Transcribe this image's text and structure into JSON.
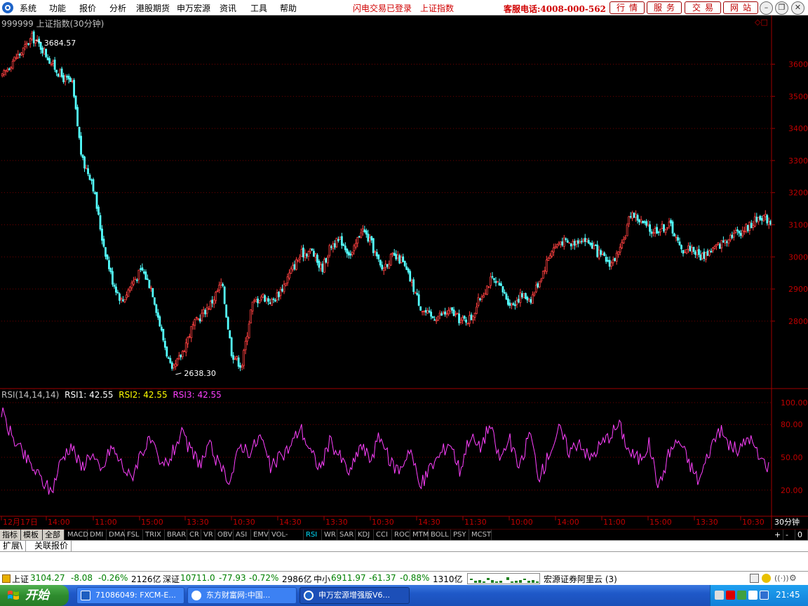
{
  "menu": {
    "items": [
      "系统",
      "功能",
      "报价",
      "分析",
      "港股期货",
      "申万宏源",
      "资讯",
      "工具",
      "帮助"
    ],
    "flash_status": "闪电交易已登录",
    "index_link": "上证指数",
    "hotline": "客服电话:4008-000-562",
    "buttons": [
      "行情",
      "服务",
      "交易",
      "网站"
    ],
    "window_controls": [
      "minimize-icon",
      "restore-icon",
      "close-icon"
    ]
  },
  "chart": {
    "title": "999999 上证指数(30分钟)",
    "controls": "◇□",
    "high_label": "3684.57",
    "low_label": "2638.30",
    "rsi_params": "RSI(14,14,14)",
    "rsi1": "RSI1: 42.55",
    "rsi2": "RSI2: 42.55",
    "rsi3": "RSI3: 42.55",
    "time_labels": [
      "12月17日",
      "14:00",
      "11:00",
      "15:00",
      "13:30",
      "10:30",
      "14:30",
      "13:30",
      "10:30",
      "14:30",
      "11:30",
      "10:00",
      "14:00",
      "11:00",
      "15:00",
      "13:30",
      "10:30"
    ],
    "period_label": "30分钟"
  },
  "chart_data": [
    {
      "type": "candlestick",
      "title": "999999 上证指数(30分钟)",
      "yticks": [
        3600,
        3500,
        3400,
        3300,
        3200,
        3100,
        3000,
        2900,
        2800
      ],
      "ylim": [
        2590,
        3730
      ],
      "annotations": [
        {
          "text": "3684.57",
          "value": 3684.57
        },
        {
          "text": "2638.30",
          "value": 2638.3
        }
      ],
      "close_path": [
        3560,
        3610,
        3640,
        3684.57,
        3650,
        3600,
        3560,
        3540,
        3300,
        3240,
        3060,
        2930,
        2860,
        2920,
        2960,
        2900,
        2760,
        2638.3,
        2700,
        2780,
        2820,
        2860,
        2920,
        2700,
        2660,
        2850,
        2880,
        2860,
        2900,
        2960,
        3010,
        3020,
        2960,
        3040,
        3050,
        3000,
        3090,
        3040,
        2960,
        3000,
        2990,
        2920,
        2840,
        2810,
        2820,
        2830,
        2800,
        2810,
        2880,
        2930,
        2900,
        2850,
        2880,
        2870,
        2940,
        3020,
        3050,
        3040,
        3060,
        3040,
        3000,
        2980,
        3020,
        3140,
        3110,
        3080,
        3090,
        3100,
        3020,
        3030,
        3000,
        3020,
        3040,
        3070,
        3080,
        3100,
        3130,
        3110
      ]
    },
    {
      "type": "line",
      "title": "RSI(14,14,14)",
      "yticks": [
        100.0,
        80.0,
        50.0,
        20.0
      ],
      "ylim": [
        0,
        100
      ],
      "series": [
        {
          "name": "RSI1",
          "last": 42.55
        },
        {
          "name": "RSI2",
          "last": 42.55
        },
        {
          "name": "RSI3",
          "last": 42.55
        }
      ],
      "rsi_path": [
        92,
        70,
        55,
        42,
        30,
        18,
        48,
        62,
        40,
        55,
        35,
        60,
        45,
        30,
        55,
        65,
        40,
        50,
        72,
        55,
        45,
        60,
        38,
        30,
        62,
        55,
        70,
        40,
        50,
        60,
        78,
        55,
        40,
        65,
        50,
        35,
        62,
        48,
        70,
        45,
        38,
        60,
        22,
        40,
        52,
        65,
        38,
        70,
        58,
        80,
        48,
        66,
        38,
        74,
        30,
        55,
        76,
        55,
        66,
        48,
        60,
        70,
        80,
        55,
        48,
        62,
        22,
        55,
        66,
        45,
        28,
        55,
        76,
        62,
        55,
        70,
        50,
        42
      ]
    }
  ],
  "indicator_tabs": [
    "指标",
    "模板",
    "全部",
    "MACD",
    "DMI",
    "DMA",
    "FSL",
    "TRIX",
    "BRAR",
    "CR",
    "VR",
    "OBV",
    "ASI",
    "EMV",
    "VOL-TDX",
    "RSI",
    "WR",
    "SAR",
    "KDJ",
    "CCI",
    "ROC",
    "MTM",
    "BOLL",
    "PSY",
    "MCST"
  ],
  "zoom_controls": [
    "+",
    "-",
    "0"
  ],
  "ext_tabs": [
    "扩展\\",
    "关联报价"
  ],
  "status": {
    "sh_label": "上证",
    "sh_value": "3104.27",
    "sh_change": "-8.08",
    "sh_pct": "-0.26%",
    "sh_amount": "2126亿",
    "sz_label": "深证",
    "sz_value": "10711.0",
    "sz_change": "-77.93",
    "sz_pct": "-0.72%",
    "sz_amount": "2986亿",
    "sme_label": "中小",
    "sme_value": "6911.97",
    "sme_change": "-61.37",
    "sme_pct": "-0.88%",
    "sme_amount": "1310亿",
    "broker": "宏源证券阿里云 (3)"
  },
  "taskbar": {
    "start": "开始",
    "tasks": [
      "71086049: FXCM-E...",
      "东方财富网:中国...",
      "申万宏源增强版V6..."
    ],
    "clock": "21:45"
  },
  "colors": {
    "up": "#ff4040",
    "down": "#54ffff",
    "axis": "#a00000",
    "rsi": "#ff40ff"
  }
}
